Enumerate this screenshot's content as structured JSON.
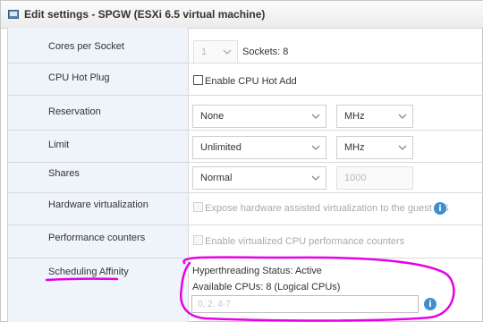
{
  "window": {
    "title": "Edit settings - SPGW (ESXi 6.5 virtual machine)"
  },
  "rows": {
    "cores_per_socket": {
      "label": "Cores per Socket",
      "value": "1",
      "sockets_text": "Sockets: 8"
    },
    "cpu_hot_plug": {
      "label": "CPU Hot Plug",
      "checkbox_label": "Enable CPU Hot Add",
      "checked": false
    },
    "reservation": {
      "label": "Reservation",
      "value": "None",
      "unit": "MHz"
    },
    "limit": {
      "label": "Limit",
      "value": "Unlimited",
      "unit": "MHz"
    },
    "shares": {
      "label": "Shares",
      "value": "Normal",
      "amount": "1000"
    },
    "hardware_virtualization": {
      "label": "Hardware virtualization",
      "checkbox_label": "Expose hardware assisted virtualization to the guest OS",
      "checked": false
    },
    "performance_counters": {
      "label": "Performance counters",
      "checkbox_label": "Enable virtualized CPU performance counters",
      "checked": false
    },
    "scheduling_affinity": {
      "label": "Scheduling Affinity",
      "hyperthreading_status": "Hyperthreading Status: Active",
      "available_cpus": "Available CPUs: 8 (Logical CPUs)",
      "cpu_input_placeholder": "0, 2, 4-7"
    }
  },
  "colors": {
    "annotation": "#e600e6",
    "info_icon": "#3d8fd0",
    "label_bg": "#eef4f9"
  }
}
